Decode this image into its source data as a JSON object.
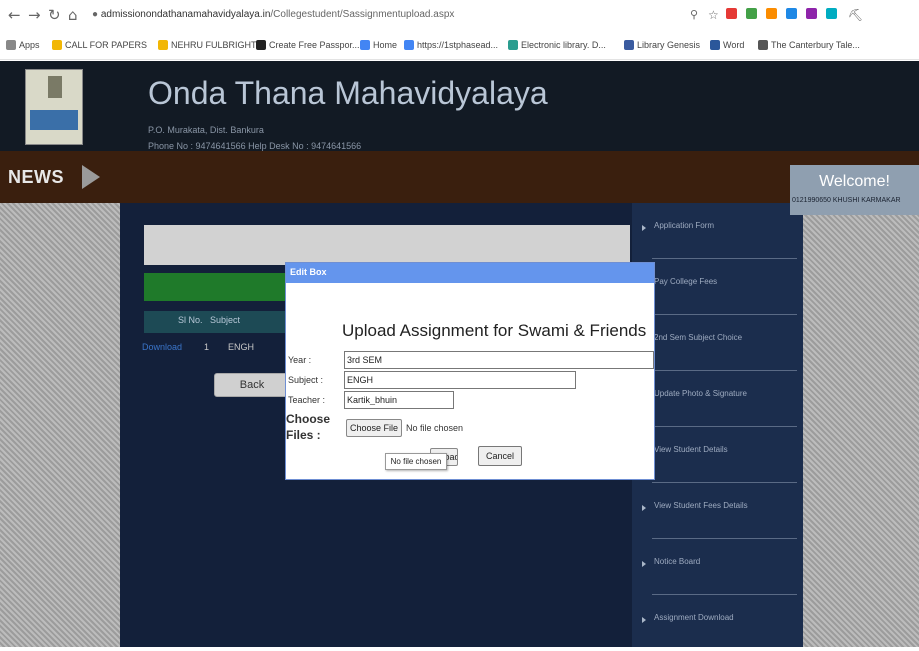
{
  "browser": {
    "url_host": "admissionondathanamahavidyalaya.in",
    "url_path": "/Collegestudent/Sassignmentupload.aspx",
    "bookmarks": [
      {
        "label": "Apps",
        "color": "#888888"
      },
      {
        "label": "CALL FOR PAPERS",
        "color": "#f2b705"
      },
      {
        "label": "NEHRU FULBRIGHT",
        "color": "#f2b705"
      },
      {
        "label": "Create Free Passpor...",
        "color": "#222222"
      },
      {
        "label": "Home",
        "color": "#4285f4"
      },
      {
        "label": "https://1stphasead...",
        "color": "#4285f4"
      },
      {
        "label": "Electronic library. D...",
        "color": "#2a9d8f"
      },
      {
        "label": "Library Genesis",
        "color": "#3a5ba0"
      },
      {
        "label": "Word",
        "color": "#2b579a"
      },
      {
        "label": "The Canterbury Tale...",
        "color": "#555555"
      }
    ],
    "extension_colors": [
      "#e53935",
      "#43a047",
      "#fb8c00",
      "#1e88e5",
      "#8e24aa",
      "#00acc1",
      "#555555"
    ]
  },
  "header": {
    "title": "Onda Thana Mahavidyalaya",
    "address": "P.O. Murakata, Dist. Bankura",
    "phone": "Phone No : 9474641566    Help Desk No : 9474641566"
  },
  "newsbar": {
    "label": "NEWS",
    "welcome_title": "Welcome!",
    "welcome_user": "0121990650 KHUSHI KARMAKAR"
  },
  "main": {
    "table_headers": {
      "slno": "Sl No.",
      "subject": "Subject"
    },
    "row": {
      "download": "Download",
      "slno": "1",
      "subject": "ENGH"
    },
    "back_label": "Back"
  },
  "sidebar": {
    "items": [
      {
        "label": "Application Form"
      },
      {
        "label": "Pay College Fees"
      },
      {
        "label": "2nd Sem Subject Choice"
      },
      {
        "label": "Update Photo & Signature"
      },
      {
        "label": "View Student Details"
      },
      {
        "label": "View Student Fees Details"
      },
      {
        "label": "Notice Board"
      },
      {
        "label": "Assignment Download"
      }
    ]
  },
  "modal": {
    "title": "Edit Box",
    "heading": "Upload Assignment for Swami & Friends",
    "year_label": "Year :",
    "year_value": "3rd SEM",
    "subject_label": "Subject :",
    "subject_value": "ENGH",
    "teacher_label": "Teacher :",
    "teacher_value": "Kartik_bhuin",
    "choose_label": "Choose Files :",
    "choose_button": "Choose File",
    "no_file": "No file chosen",
    "upload_button": "Upload",
    "cancel_button": "Cancel",
    "tooltip": "No file chosen"
  }
}
